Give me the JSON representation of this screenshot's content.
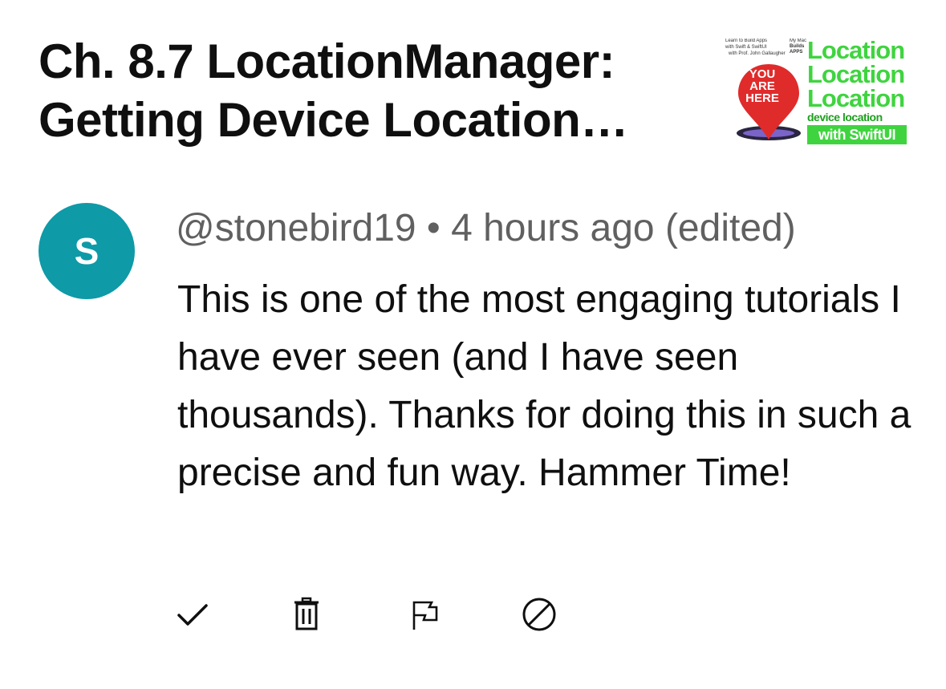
{
  "video": {
    "title": "Ch. 8.7 LocationManager: Getting Device Location…",
    "thumbnail": {
      "top_left_lines": [
        "Learn to Build Apps",
        "with Swift & SwiftUI",
        "with Prof. John Gallaugher"
      ],
      "top_right_lines": [
        "My Mac",
        "Builds",
        "APPS"
      ],
      "pin_text": "YOU ARE HERE",
      "headline_lines": [
        "Location",
        "Location",
        "Location"
      ],
      "subline": "device location",
      "footer": "with SwiftUI",
      "colors": {
        "green": "#3fd43f",
        "pin_red": "#e02b2b"
      }
    }
  },
  "comment": {
    "avatar_letter": "S",
    "avatar_color": "#0e9aa7",
    "author": "@stonebird19",
    "separator": "•",
    "timestamp": "4 hours ago (edited)",
    "text": "This is one of the most engaging tutorials I have ever seen (and I have seen thousands). Thanks for doing this in such a precise and fun way. Hammer Time!"
  },
  "actions": [
    {
      "name": "approve",
      "icon": "checkmark-icon"
    },
    {
      "name": "remove",
      "icon": "trash-icon"
    },
    {
      "name": "report",
      "icon": "flag-icon"
    },
    {
      "name": "hide-user",
      "icon": "block-icon"
    }
  ]
}
